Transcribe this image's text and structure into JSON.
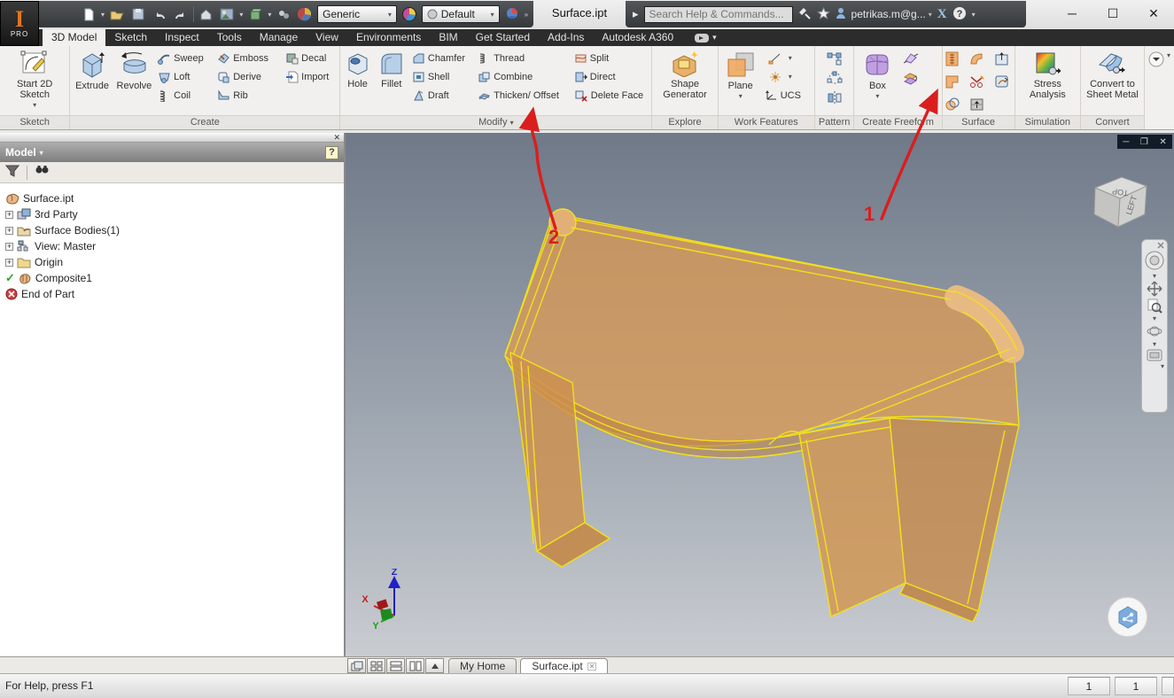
{
  "titlebar": {
    "document_title": "Surface.ipt",
    "material_select": "Generic",
    "appearance_select": "Default",
    "search_placeholder": "Search Help & Commands...",
    "account": "petrikas.m@g..."
  },
  "tabs": [
    "3D Model",
    "Sketch",
    "Inspect",
    "Tools",
    "Manage",
    "View",
    "Environments",
    "BIM",
    "Get Started",
    "Add-Ins",
    "Autodesk A360"
  ],
  "ribbon": {
    "sketch": {
      "start_2d_sketch": "Start 2D Sketch",
      "panel_label": "Sketch"
    },
    "create": {
      "extrude": "Extrude",
      "revolve": "Revolve",
      "sweep": "Sweep",
      "loft": "Loft",
      "coil": "Coil",
      "emboss": "Emboss",
      "derive": "Derive",
      "rib": "Rib",
      "decal": "Decal",
      "import": "Import",
      "panel_label": "Create"
    },
    "modify": {
      "hole": "Hole",
      "fillet": "Fillet",
      "chamfer": "Chamfer",
      "shell": "Shell",
      "draft": "Draft",
      "thread": "Thread",
      "combine": "Combine",
      "thicken_offset": "Thicken/ Offset",
      "split": "Split",
      "direct": "Direct",
      "delete_face": "Delete Face",
      "panel_label": "Modify"
    },
    "explore": {
      "shape_generator": "Shape Generator",
      "panel_label": "Explore"
    },
    "work_features": {
      "plane": "Plane",
      "ucs": "UCS",
      "panel_label": "Work Features"
    },
    "pattern": {
      "panel_label": "Pattern"
    },
    "create_freeform": {
      "box": "Box",
      "panel_label": "Create Freeform"
    },
    "surface": {
      "panel_label": "Surface"
    },
    "simulation": {
      "stress_analysis": "Stress Analysis",
      "panel_label": "Simulation"
    },
    "convert": {
      "sheet_metal": "Convert to Sheet Metal",
      "panel_label": "Convert"
    }
  },
  "browser": {
    "header": "Model",
    "tree": [
      {
        "label": "Surface.ipt"
      },
      {
        "label": "3rd Party"
      },
      {
        "label": "Surface Bodies(1)"
      },
      {
        "label": "View: Master"
      },
      {
        "label": "Origin"
      },
      {
        "label": "Composite1"
      },
      {
        "label": "End of Part"
      }
    ]
  },
  "viewport": {
    "viewcube": {
      "top": "TOP",
      "left": "LEFT"
    },
    "triad": {
      "x": "X",
      "y": "Y",
      "z": "Z"
    },
    "annotations": {
      "label_1": "1",
      "label_2": "2"
    }
  },
  "doctabs": {
    "my_home": "My Home",
    "surface": "Surface.ipt"
  },
  "statusbar": {
    "help": "For Help, press F1",
    "counter_1": "1",
    "counter_2": "1"
  },
  "colors": {
    "edge_yellow": "#f2e01b",
    "surface_tan": "#d79a55",
    "annotation_red": "#da1e1e",
    "viewport_top": "#6f7988",
    "viewport_bottom": "#c9ccd1"
  }
}
